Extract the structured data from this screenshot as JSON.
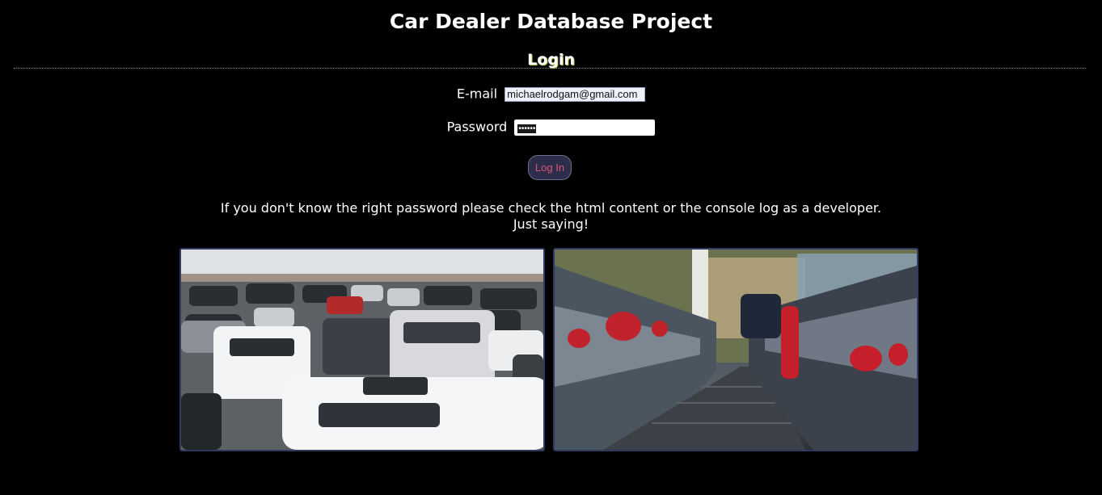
{
  "header": {
    "app_title": "Car Dealer Database Project",
    "section_title": "Login"
  },
  "form": {
    "email_label": "E-mail",
    "email_value": "michaelrodgam@gmail.com",
    "password_label": "Password",
    "password_value": "••••••",
    "login_button_label": "Log In"
  },
  "hint": {
    "line1": "If you don't know the right password please check the html content or the console log as a developer.",
    "line2": "Just saying!"
  },
  "images": {
    "left_icon": "car-lot-indoor-photo",
    "right_icon": "car-lot-outdoor-photo"
  },
  "colors": {
    "background": "#000000",
    "button_bg": "#2b2d4a",
    "button_text": "#e0507a",
    "image_border": "#2f3a5e"
  }
}
